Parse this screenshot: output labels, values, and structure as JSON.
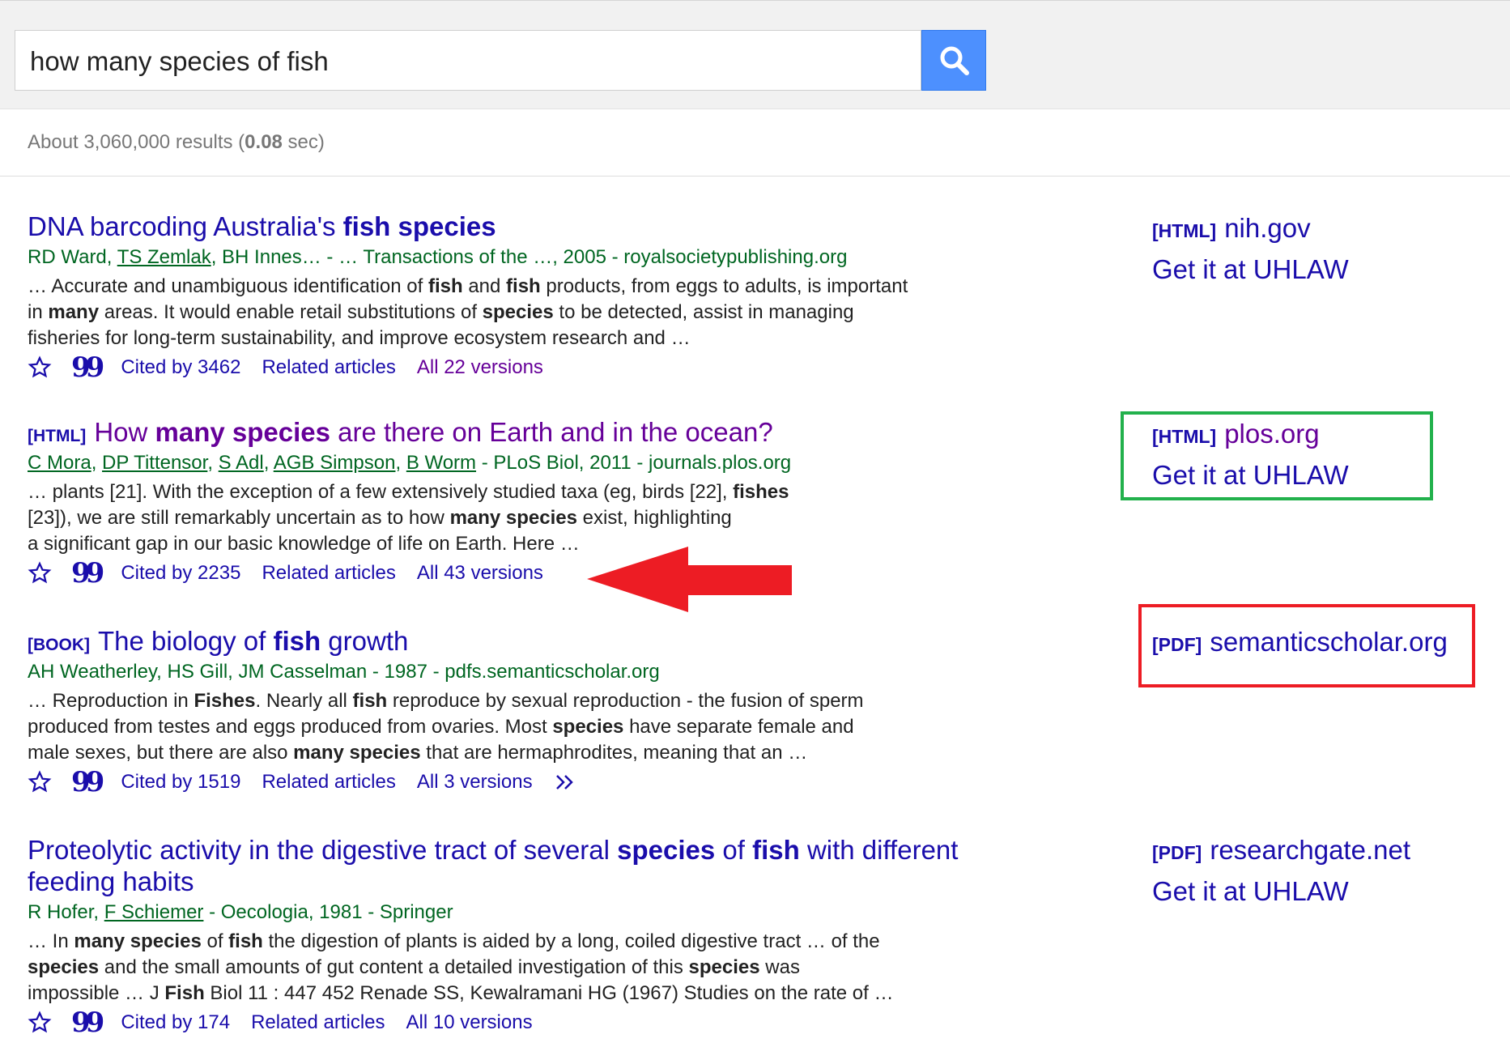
{
  "search": {
    "query": "how many species of fish"
  },
  "stats": {
    "prefix": "About 3,060,000 results (",
    "time": "0.08",
    "suffix": " sec)"
  },
  "results": [
    {
      "title_parts": [
        "DNA barcoding Australia's ",
        "fish species"
      ],
      "meta": {
        "authors": [
          "RD Ward",
          "TS Zemlak",
          "BH Innes…"
        ],
        "source": " - … Transactions of the …, 2005 - royalsocietypublishing.org"
      },
      "snippet": [
        [
          "… Accurate and unambiguous identification of ",
          "fish",
          " and ",
          "fish",
          " products, from eggs to adults, is important"
        ],
        [
          "in ",
          "many",
          " areas. It would enable retail substitutions of ",
          "species",
          " to be detected, assist in managing"
        ],
        [
          "fisheries for long-term sustainability, and improve ecosystem research and …"
        ]
      ],
      "cited": "Cited by 3462",
      "related": "Related articles",
      "versions": "All 22 versions"
    },
    {
      "tag": "[HTML]",
      "title_parts": [
        "How ",
        "many species",
        " are there on Earth and in the ocean?"
      ],
      "meta": {
        "authors": [
          "C Mora",
          "DP Tittensor",
          "S Adl",
          "AGB Simpson",
          "B Worm"
        ],
        "source": " - PLoS Biol, 2011 - journals.plos.org"
      },
      "snippet": [
        [
          "… plants [21]. With the exception of a few extensively studied taxa (eg, birds [22], ",
          "fishes"
        ],
        [
          "[23]), we are still remarkably uncertain as to how ",
          "many species",
          " exist, highlighting"
        ],
        [
          "a significant gap in our basic knowledge of life on Earth. Here …"
        ]
      ],
      "cited": "Cited by 2235",
      "related": "Related articles",
      "versions": "All 43 versions"
    },
    {
      "tag": "[BOOK]",
      "title_parts": [
        "The biology of ",
        "fish",
        " growth"
      ],
      "meta": {
        "authors": [],
        "source": "AH Weatherley, HS Gill, JM Casselman - 1987 - pdfs.semanticscholar.org"
      },
      "snippet": [
        [
          "… Reproduction in ",
          "Fishes",
          ". Nearly all ",
          "fish",
          " reproduce by sexual reproduction - the fusion of sperm"
        ],
        [
          "produced from testes and eggs produced from ovaries. Most ",
          "species",
          " have separate female and"
        ],
        [
          "male sexes, but there are also ",
          "many species",
          " that are hermaphrodites, meaning that an …"
        ]
      ],
      "cited": "Cited by 1519",
      "related": "Related articles",
      "versions": "All 3 versions"
    },
    {
      "title_parts": [
        "Proteolytic activity in the digestive tract of several ",
        "species",
        " of ",
        "fish",
        " with different feeding habits"
      ],
      "meta": {
        "authors": [
          "R Hofer",
          "F Schiemer"
        ],
        "source": " - Oecologia, 1981 - Springer"
      },
      "snippet": [
        [
          "… In ",
          "many species",
          " of ",
          "fish",
          " the digestion of plants is aided by a long, coiled digestive tract … of the"
        ],
        [
          "species",
          " and the small amounts of gut content a detailed investigation of this ",
          "species",
          " was"
        ],
        [
          "impossible … J ",
          "Fish",
          " Biol 11 : 447 452 Renade SS, Kewalramani HG (1967) Studies on the rate of …"
        ]
      ],
      "cited": "Cited by 174",
      "related": "Related articles",
      "versions": "All 10 versions"
    }
  ],
  "side_links": [
    {
      "tag": "[HTML]",
      "domain": "nih.gov",
      "get": "Get it at UHLAW"
    },
    {
      "tag": "[HTML]",
      "domain": "plos.org",
      "get": "Get it at UHLAW"
    },
    {
      "tag": "[PDF]",
      "domain": "semanticscholar.org"
    },
    {
      "tag": "[PDF]",
      "domain": "researchgate.net",
      "get": "Get it at UHLAW"
    }
  ],
  "colors": {
    "link": "#1a0dab",
    "visited": "#660099",
    "meta_green": "#006621",
    "highlight_green": "#22b14c",
    "highlight_red": "#ed1c24",
    "search_button": "#4d90fe"
  },
  "icons": [
    "search-icon",
    "star-icon",
    "quote-icon",
    "chevrons-icon",
    "red-arrow-annotation"
  ]
}
